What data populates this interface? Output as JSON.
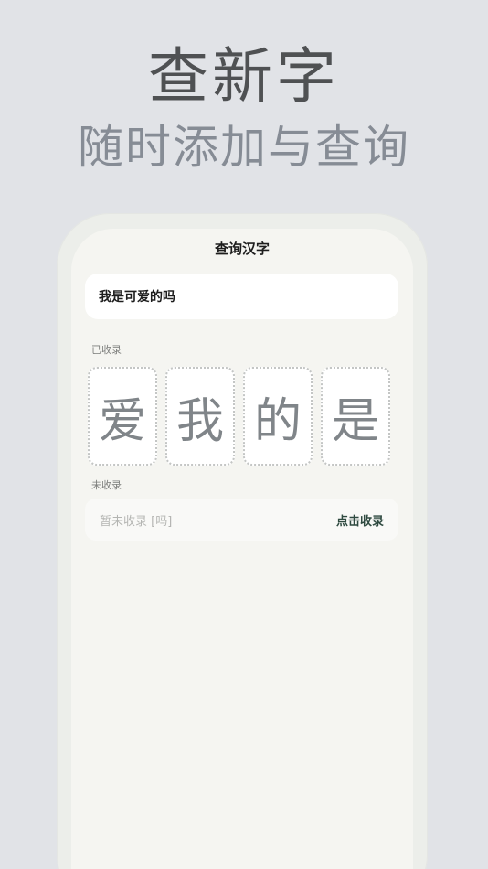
{
  "hero": {
    "title": "查新字",
    "subtitle": "随时添加与查询"
  },
  "screen": {
    "nav_title": "查询汉字",
    "query_text": "我是可爱的吗",
    "collected_label": "已收录",
    "collected_chars": [
      "爱",
      "我",
      "的",
      "是"
    ],
    "uncollected_label": "未收录",
    "uncollected_text": "暂未收录 [吗]",
    "collect_button": "点击收录"
  },
  "colors": {
    "background": "#e1e3e7",
    "card_bg": "#f5f5f1",
    "accent": "#2f4a40"
  }
}
